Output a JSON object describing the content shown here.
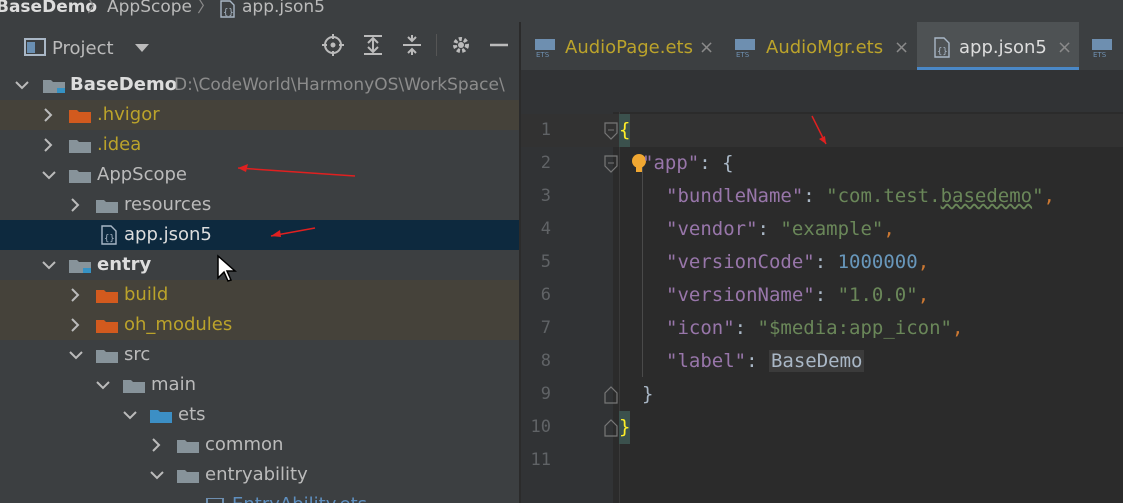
{
  "breadcrumb": {
    "segments": [
      "BaseDemo",
      "AppScope",
      "app.json5"
    ],
    "separator": "〉"
  },
  "project_panel": {
    "title": "Project",
    "dropdown_icon": "caret-down-icon",
    "toolbar_icons": [
      "locate-icon",
      "expand-all-icon",
      "collapse-all-icon",
      "gear-icon",
      "minimize-icon"
    ]
  },
  "tree": [
    {
      "label": "BaseDemo",
      "path": "D:\\CodeWorld\\HarmonyOS\\WorkSpace\\",
      "icon": "module-folder-icon",
      "expanded": true,
      "bold": true
    },
    {
      "label": ".hvigor",
      "icon": "excluded-folder-icon",
      "expanded": false,
      "excluded": true
    },
    {
      "label": ".idea",
      "icon": "folder-icon",
      "expanded": false
    },
    {
      "label": "AppScope",
      "icon": "folder-icon",
      "expanded": true
    },
    {
      "label": "resources",
      "icon": "folder-icon",
      "expanded": false
    },
    {
      "label": "app.json5",
      "icon": "json-file-icon",
      "selected": true
    },
    {
      "label": "entry",
      "icon": "module-folder-icon",
      "expanded": true,
      "bold": true
    },
    {
      "label": "build",
      "icon": "excluded-folder-icon",
      "expanded": false,
      "excluded": true
    },
    {
      "label": "oh_modules",
      "icon": "excluded-folder-icon",
      "expanded": false,
      "excluded": true
    },
    {
      "label": "src",
      "icon": "folder-icon",
      "expanded": true
    },
    {
      "label": "main",
      "icon": "folder-icon",
      "expanded": true
    },
    {
      "label": "ets",
      "icon": "source-folder-icon",
      "expanded": true
    },
    {
      "label": "common",
      "icon": "folder-icon",
      "expanded": false
    },
    {
      "label": "entryability",
      "icon": "folder-icon",
      "expanded": true
    },
    {
      "label": "EntryAbility.ets",
      "icon": "ets-file-icon"
    }
  ],
  "editor_tabs": [
    {
      "label": "AudioPage.ets",
      "icon": "ets-file-icon",
      "close": "×",
      "active": false
    },
    {
      "label": "AudioMgr.ets",
      "icon": "ets-file-icon",
      "close": "×",
      "active": false
    },
    {
      "label": "app.json5",
      "icon": "json-file-icon",
      "close": "×",
      "active": true
    }
  ],
  "code": {
    "line_numbers": [
      "1",
      "2",
      "3",
      "4",
      "5",
      "6",
      "7",
      "8",
      "9",
      "10",
      "11"
    ],
    "open_brace": "{",
    "app_key": "\"app\"",
    "app_open": ": {",
    "entries": [
      {
        "key": "\"bundleName\"",
        "value": "\"com.test.",
        "value_squiggle": "basedemo",
        "value_end": "\"",
        "type": "string"
      },
      {
        "key": "\"vendor\"",
        "value": "\"example\"",
        "type": "string"
      },
      {
        "key": "\"versionCode\"",
        "value": "1000000",
        "type": "number"
      },
      {
        "key": "\"versionName\"",
        "value": "\"1.0.0\"",
        "type": "string"
      },
      {
        "key": "\"icon\"",
        "value": "\"$media:app_icon\"",
        "type": "string"
      },
      {
        "key": "\"label\"",
        "value": "BaseDemo",
        "type": "plain"
      }
    ],
    "inner_close": "}",
    "outer_close": "}",
    "colon": ": ",
    "comma": ","
  },
  "colors": {
    "accent": "#4a88c7",
    "key": "#9876aa",
    "string": "#6a8759",
    "number": "#6897bb",
    "excluded_text": "#bba32b",
    "annotation_arrow": "#e02020"
  }
}
